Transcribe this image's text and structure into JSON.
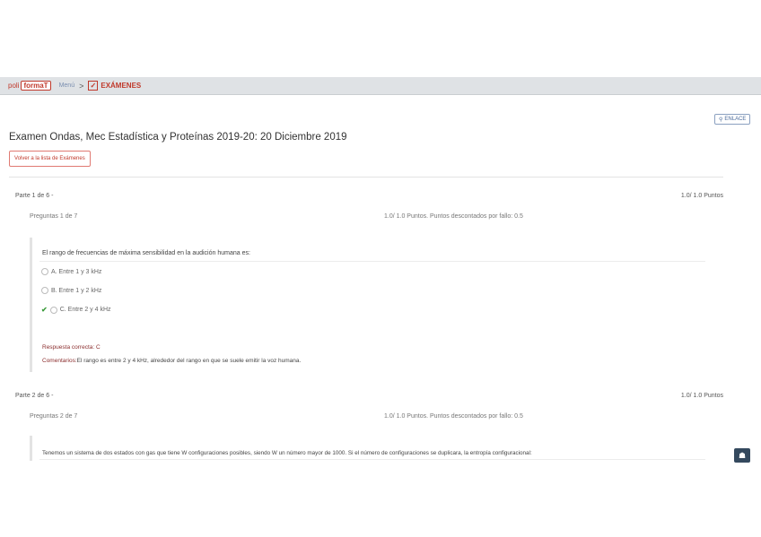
{
  "header": {
    "logo_poli": "poli",
    "logo_formaT": "formaT",
    "breadcrumb_home": "Menú",
    "breadcrumb_separator": ">",
    "breadcrumb_current": "EXÁMENES"
  },
  "enlace_label": "ENLACE",
  "exam_title": "Examen Ondas, Mec Estadística y Proteínas 2019-20: 20 Diciembre 2019",
  "back_button": "Volver a la lista de Exámenes",
  "parts": [
    {
      "label": "Parte 1 de 6 -",
      "points": "1.0/ 1.0 Puntos",
      "question_label": "Preguntas 1 de 7",
      "question_points": "1.0/ 1.0 Puntos. Puntos descontados por fallo: 0.5",
      "question_text": "El rango de frecuencias de máxima sensibilidad en la audición humana es:",
      "options": [
        "A. Entre 1 y 3 kHz",
        "B. Entre 1 y 2 kHz",
        "C. Entre 2 y 4 kHz"
      ],
      "answer": "Respuesta correcta: C",
      "comment_label": "Comentarios:",
      "comment_text": "El rango es entre 2 y 4 kHz, alrededor del rango en que se suele emitir la voz humana."
    },
    {
      "label": "Parte 2 de 6 -",
      "points": "1.0/ 1.0 Puntos",
      "question_label": "Preguntas 2 de 7",
      "question_points": "1.0/ 1.0 Puntos. Puntos descontados por fallo: 0.5",
      "question_text": "Tenemos un sistema de dos estados con gas que tiene W configuraciones posibles, siendo W un número mayor de 1000. Si el número de configuraciones se duplicara, la entropía configuracional:"
    }
  ]
}
